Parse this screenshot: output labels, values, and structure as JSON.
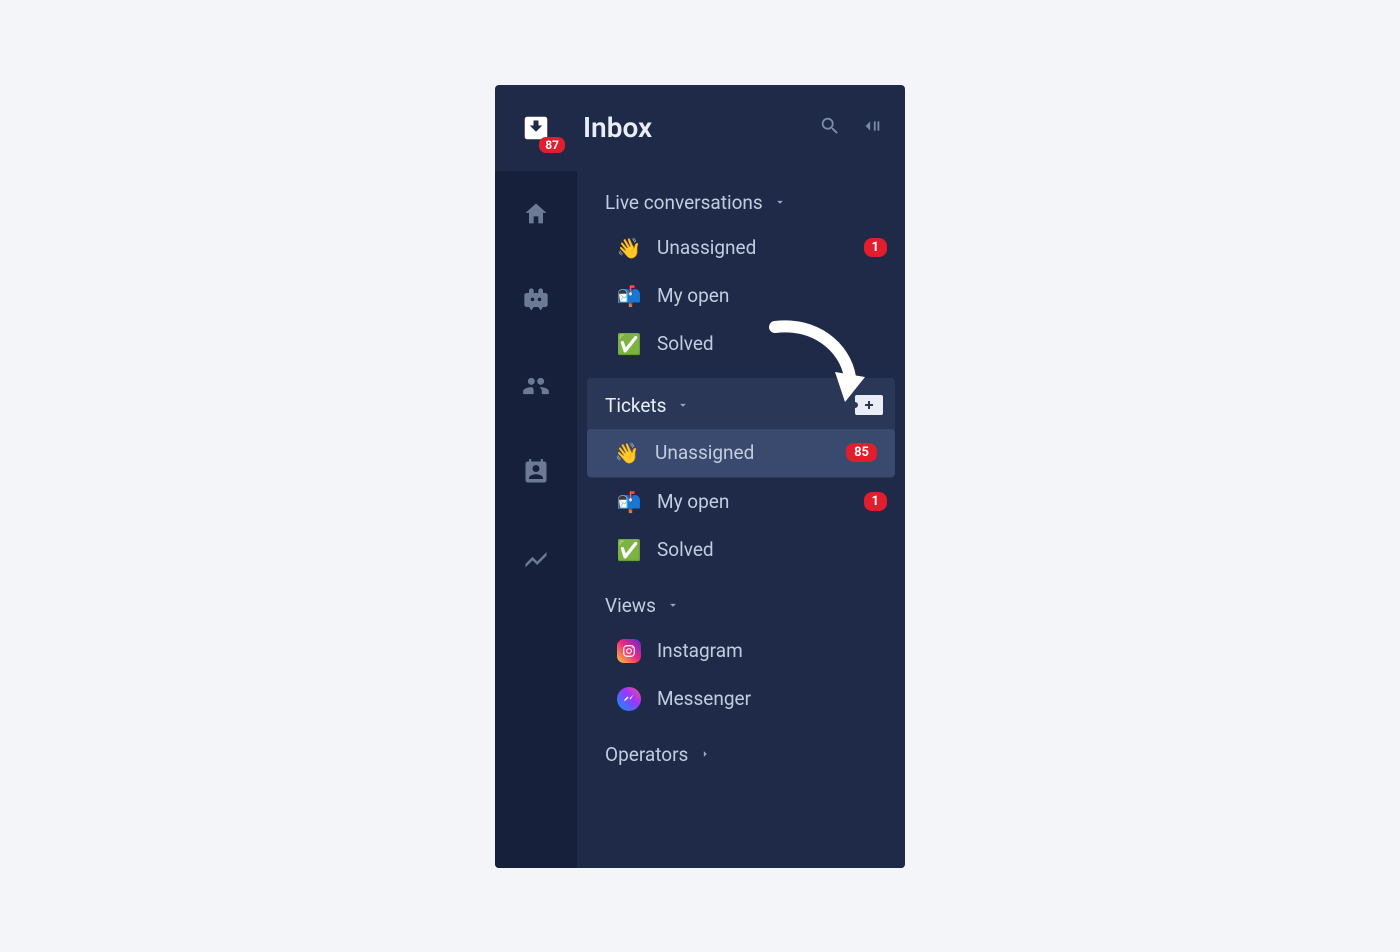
{
  "header": {
    "title": "Inbox",
    "inbox_badge": "87"
  },
  "sections": {
    "live": {
      "title": "Live conversations",
      "items": [
        {
          "emoji": "👋",
          "label": "Unassigned",
          "badge": "1"
        },
        {
          "emoji": "📬",
          "label": "My open",
          "badge": ""
        },
        {
          "emoji": "✅",
          "label": "Solved",
          "badge": ""
        }
      ]
    },
    "tickets": {
      "title": "Tickets",
      "items": [
        {
          "emoji": "👋",
          "label": "Unassigned",
          "badge": "85"
        },
        {
          "emoji": "📬",
          "label": "My open",
          "badge": "1"
        },
        {
          "emoji": "✅",
          "label": "Solved",
          "badge": ""
        }
      ]
    },
    "views": {
      "title": "Views",
      "items": [
        {
          "label": "Instagram"
        },
        {
          "label": "Messenger"
        }
      ]
    },
    "operators": {
      "title": "Operators"
    }
  }
}
